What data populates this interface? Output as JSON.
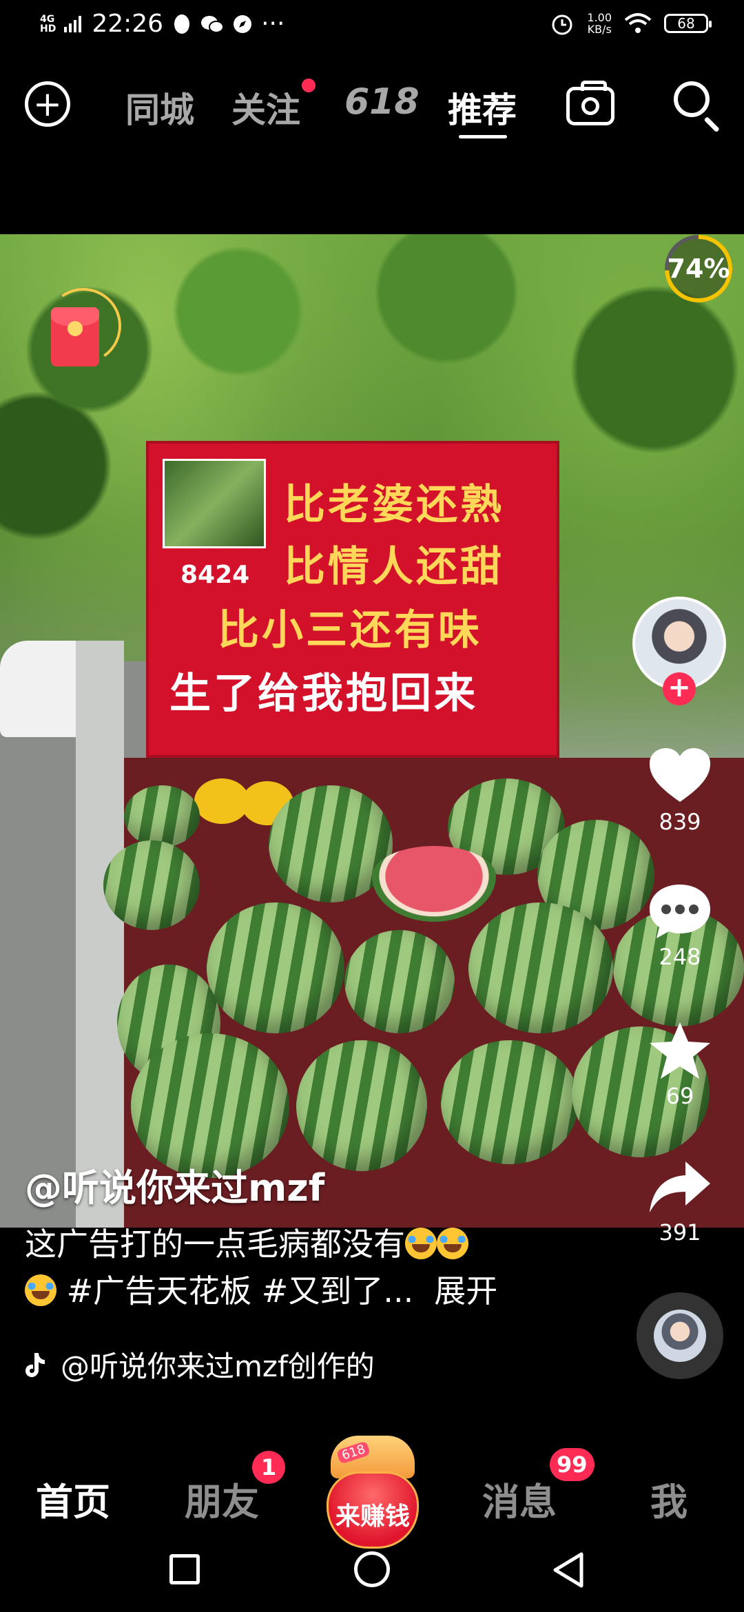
{
  "status_bar": {
    "network_top": "4G",
    "network_bottom": "HD",
    "time": "22:26",
    "more": "···",
    "speed_value": "1.00",
    "speed_unit": "KB/s",
    "battery": "68",
    "icons": [
      "qq-icon",
      "wechat-icon",
      "compass-icon",
      "alarm-icon",
      "wifi-icon",
      "battery-icon"
    ]
  },
  "top_nav": {
    "add_icon": "plus-circle-icon",
    "tabs": [
      {
        "label": "同城"
      },
      {
        "label": "关注",
        "has_dot": true
      },
      {
        "label": "618"
      },
      {
        "label": "推荐",
        "active": true
      }
    ],
    "camera_icon": "camera-icon",
    "search_icon": "search-icon"
  },
  "video": {
    "sign": {
      "code": "8424",
      "lines": [
        "比老婆还熟",
        "比情人还甜",
        "比小三还有味",
        "生了给我抱回来"
      ]
    },
    "progress": {
      "label": "74%",
      "value": 0.74
    }
  },
  "side_actions": {
    "like_count": "839",
    "comment_count": "248",
    "favorite_count": "69",
    "share_count": "391"
  },
  "post": {
    "author": "@听说你来过mzf",
    "caption_line1": "这广告打的一点毛病都没有",
    "caption_line2": "#广告天花板 #又到了...",
    "expand": "展开",
    "music": "@听说你来过mzf创作的"
  },
  "bottom_nav": {
    "home": "首页",
    "friends": "朋友",
    "friends_badge": "1",
    "earn_label": "来赚钱",
    "earn_tag": "618",
    "messages": "消息",
    "messages_badge": "99",
    "me": "我"
  },
  "colors": {
    "accent": "#fe2c55",
    "background": "#000000",
    "sign_red": "#d4112a",
    "sign_yellow": "#ffd85a"
  }
}
